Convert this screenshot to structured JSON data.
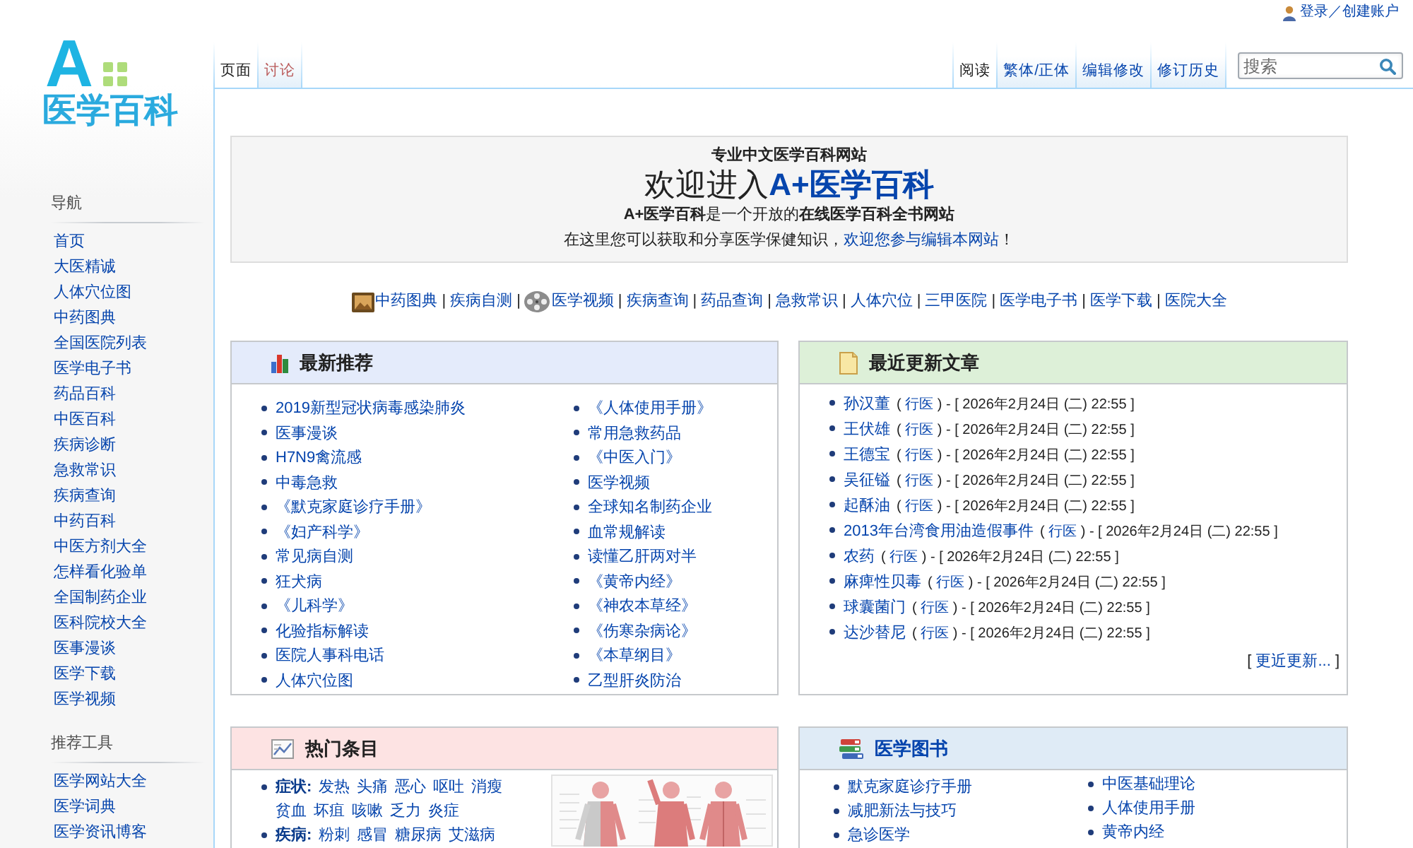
{
  "logo": {
    "letter": "A",
    "name": "医学百科"
  },
  "sidebar": {
    "sections": [
      {
        "heading": "导航",
        "items": [
          "首页",
          "大医精诚",
          "人体穴位图",
          "中药图典",
          "全国医院列表",
          "医学电子书",
          "药品百科",
          "中医百科",
          "疾病诊断",
          "急救常识",
          "疾病查询",
          "中药百科",
          "中医方剂大全",
          "怎样看化验单",
          "全国制药企业",
          "医科院校大全",
          "医事漫谈",
          "医学下载",
          "医学视频"
        ]
      },
      {
        "heading": "推荐工具",
        "items": [
          "医学网站大全",
          "医学词典",
          "医学资讯博客"
        ]
      }
    ]
  },
  "personal": {
    "login": "登录／创建账户"
  },
  "page_tabs": [
    {
      "label": "页面",
      "selected": true,
      "missing": false
    },
    {
      "label": "讨论",
      "selected": false,
      "missing": true
    }
  ],
  "view_tabs": [
    {
      "label": "阅读",
      "selected": true
    },
    {
      "label": "繁体/正体",
      "selected": false
    },
    {
      "label": "编辑修改",
      "selected": false
    },
    {
      "label": "修订历史",
      "selected": false
    }
  ],
  "search": {
    "placeholder": "搜索"
  },
  "welcome": {
    "tagline": "专业中文医学百科网站",
    "title": "欢迎进入**A+医学百科**",
    "intro": "**A+医学百科**是一个开放的**在线医学百科全书网站**",
    "invite": {
      "text": "在这里您可以获取和分享医学保健知识，",
      "link": "欢迎您参与编辑本网站",
      "end": "！"
    }
  },
  "quick_links": [
    {
      "label": "中药图典",
      "kind": "image"
    },
    {
      "separator": "|",
      "label": "疾病自测",
      "kind": "text"
    },
    {
      "separator": "|",
      "label": "医学视频",
      "kind": "video"
    },
    {
      "separator": "|",
      "label": "疾病查询",
      "kind": "text"
    },
    {
      "separator": "|",
      "label": "药品查询",
      "kind": "text"
    },
    {
      "separator": "|",
      "label": "急救常识",
      "kind": "text"
    },
    {
      "separator": "|",
      "label": "人体穴位",
      "kind": "text"
    },
    {
      "separator": "|",
      "label": "三甲医院",
      "kind": "text"
    },
    {
      "separator": "|",
      "label": "医学电子书",
      "kind": "text"
    },
    {
      "separator": "|",
      "label": "医学下载",
      "kind": "text"
    },
    {
      "separator": "|",
      "label": "医院大全",
      "kind": "text"
    }
  ],
  "panels": [
    {
      "kind": "columns",
      "title": "最新推荐",
      "color": "#e4ebfb",
      "linked": false,
      "columns": [
        [
          "2019新型冠状病毒感染肺炎",
          "医事漫谈",
          "H7N9禽流感",
          "中毒急救",
          "《默克家庭诊疗手册》",
          "《妇产科学》",
          "常见病自测",
          "狂犬病",
          "《儿科学》",
          "化验指标解读",
          "医院人事科电话",
          "人体穴位图"
        ],
        [
          "《人体使用手册》",
          "常用急救药品",
          "《中医入门》",
          "医学视频",
          "全球知名制药企业",
          "血常规解读",
          "读懂乙肝两对半",
          "《黄帝内经》",
          "《神农本草经》",
          "《伤寒杂病论》",
          "《本草纲目》",
          "乙型肝炎防治"
        ]
      ]
    },
    {
      "kind": "updates",
      "title": "最近更新文章",
      "color": "#ddf0d8",
      "linked": false,
      "rows": [
        {
          "title": "孙汉董",
          "open": "(",
          "user": "行医",
          "detail": ") - [ 2026年2月24日 (二) 22:55 ]"
        },
        {
          "title": "王伏雄",
          "open": "(",
          "user": "行医",
          "detail": ") - [ 2026年2月24日 (二) 22:55 ]"
        },
        {
          "title": "王德宝",
          "open": "(",
          "user": "行医",
          "detail": ") - [ 2026年2月24日 (二) 22:55 ]"
        },
        {
          "title": "吴征镒",
          "open": "(",
          "user": "行医",
          "detail": ") - [ 2026年2月24日 (二) 22:55 ]"
        },
        {
          "title": "起酥油",
          "open": "(",
          "user": "行医",
          "detail": ") - [ 2026年2月24日 (二) 22:55 ]"
        },
        {
          "title": "2013年台湾食用油造假事件",
          "open": "(",
          "user": "行医",
          "detail": ") - [ 2026年2月24日 (二) 22:55 ]"
        },
        {
          "title": "农药",
          "open": "(",
          "user": "行医",
          "detail": ") - [ 2026年2月24日 (二) 22:55 ]"
        },
        {
          "title": "麻痺性贝毒",
          "open": "(",
          "user": "行医",
          "detail": ") - [ 2026年2月24日 (二) 22:55 ]"
        },
        {
          "title": "球囊菌门",
          "open": "(",
          "user": "行医",
          "detail": ") - [ 2026年2月24日 (二) 22:55 ]"
        },
        {
          "title": "达沙替尼",
          "open": "(",
          "user": "行医",
          "detail": ") - [ 2026年2月24日 (二) 22:55 ]"
        }
      ],
      "more": {
        "open": "[",
        "link": "更近更新...",
        "close": "]"
      }
    },
    {
      "kind": "topics",
      "title": "热门条目",
      "color": "#fde3e3",
      "linked": false,
      "topics": [
        {
          "label": "症状:",
          "lines": [
            [
              "发热",
              "头痛",
              "恶心",
              "呕吐",
              "消瘦"
            ],
            [
              "贫血",
              "坏疽",
              "咳嗽",
              "乏力",
              "炎症"
            ]
          ]
        },
        {
          "label": "疾病:",
          "lines": [
            [
              "粉刺",
              "感冒",
              "糖尿病",
              "艾滋病"
            ]
          ]
        }
      ]
    },
    {
      "kind": "columns",
      "title": "医学图书",
      "color": "#dfebf6",
      "linked": true,
      "columns": [
        [
          "默克家庭诊疗手册",
          "减肥新法与技巧",
          "急诊医学"
        ],
        [
          "中医基础理论",
          "人体使用手册",
          "黄帝内经"
        ]
      ]
    }
  ]
}
